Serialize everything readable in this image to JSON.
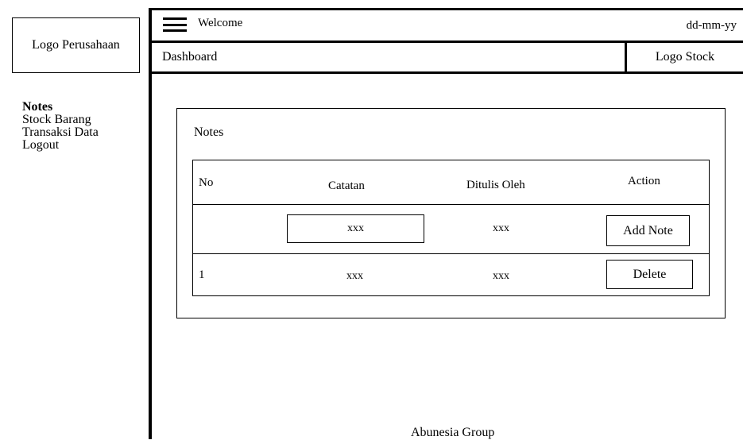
{
  "sidebar": {
    "logo_text": "Logo Perusahaan",
    "items": [
      {
        "label": "Notes",
        "active": true
      },
      {
        "label": "Stock Barang"
      },
      {
        "label": "Transaksi Data"
      },
      {
        "label": "Logout"
      }
    ]
  },
  "header": {
    "menu_icon": "hamburger-icon",
    "welcome": "Welcome",
    "date": "dd-mm-yy",
    "breadcrumb": "Dashboard",
    "logo_stock": "Logo Stock"
  },
  "main": {
    "panel_title": "Notes",
    "table": {
      "columns": [
        "No",
        "Catatan",
        "Ditulis Oleh",
        "Action"
      ],
      "input_row": {
        "catatan_value": "xxx",
        "ditulis_oleh": "xxx",
        "action_label": "Add Note"
      },
      "rows": [
        {
          "no": "1",
          "catatan": "xxx",
          "ditulis_oleh": "xxx",
          "action_label": "Delete"
        }
      ]
    }
  },
  "footer": {
    "text": "Abunesia Group"
  }
}
